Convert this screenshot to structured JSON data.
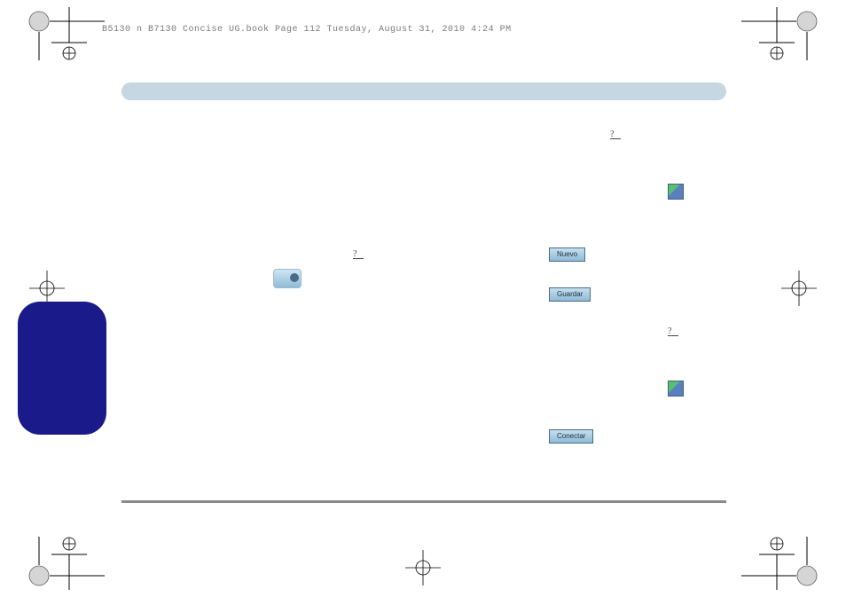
{
  "header": "B5130 n B7130 Concise UG.book  Page 112  Tuesday, August 31, 2010  4:24 PM",
  "qmark": "?",
  "buttons": {
    "nuevo": "Nuevo",
    "guardar": "Guardar",
    "conectar": "Conectar"
  }
}
